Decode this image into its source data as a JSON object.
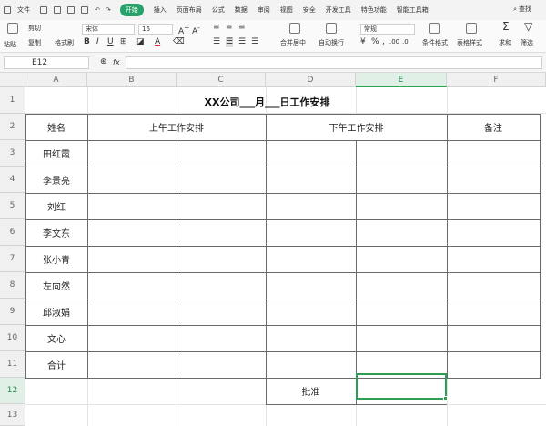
{
  "menu": {
    "file_label": "文件",
    "tabs": [
      "开始",
      "插入",
      "页面布局",
      "公式",
      "数据",
      "审阅",
      "视图",
      "安全",
      "开发工具",
      "特色功能",
      "智能工具箱"
    ],
    "active_tab": "开始",
    "search_label": "查找"
  },
  "ribbon": {
    "cut_label": "剪切",
    "paste_label": "粘贴",
    "copy_label": "复制",
    "format_painter_label": "格式刷",
    "font_name": "宋体",
    "font_size": "16",
    "number_format": "常规",
    "merge_label": "合并居中",
    "wrap_label": "自动换行",
    "conditional_format_label": "条件格式",
    "table_style_label": "表格样式",
    "sum_label": "求和",
    "filter_label": "筛选"
  },
  "formula_bar": {
    "cell_ref": "E12",
    "fx_label": "fx",
    "content": ""
  },
  "columns": [
    "A",
    "B",
    "C",
    "D",
    "E",
    "F"
  ],
  "selected_column": "E",
  "rows": [
    "1",
    "2",
    "3",
    "4",
    "5",
    "6",
    "7",
    "8",
    "9",
    "10",
    "11",
    "12",
    "13"
  ],
  "selected_row": "12",
  "sheet": {
    "title": "XX公司___月___日工作安排",
    "headers": {
      "name": "姓名",
      "morning": "上午工作安排",
      "afternoon": "下午工作安排",
      "notes": "备注"
    },
    "names": [
      "田红霞",
      "李景亮",
      "刘红",
      "李文东",
      "张小青",
      "左向然",
      "邱淑娟",
      "文心",
      "合计"
    ],
    "approve_label": "批准"
  },
  "colors": {
    "accent": "#26a26a",
    "selection": "#2e9e55"
  }
}
